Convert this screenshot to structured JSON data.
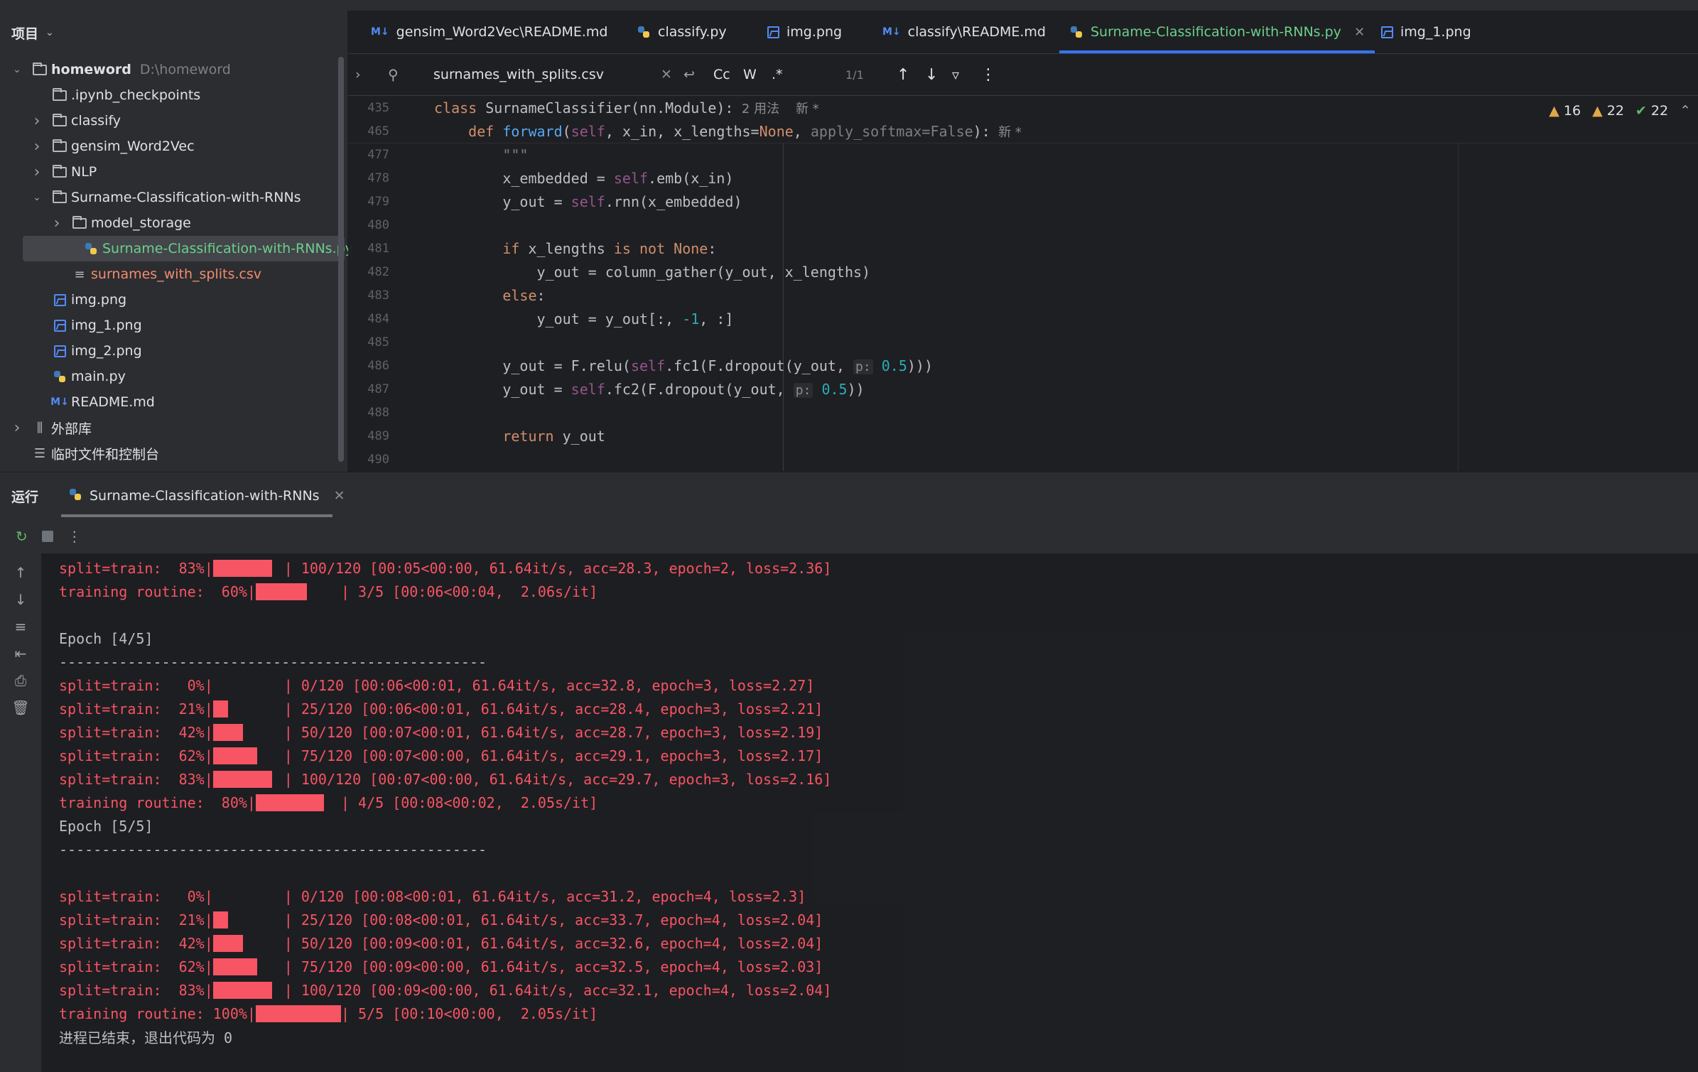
{
  "sidebar": {
    "title": "项目",
    "tree": [
      {
        "label": "homeword",
        "path": "D:\\homeword",
        "type": "folder",
        "level": 0,
        "expanded": true,
        "bold": true
      },
      {
        "label": ".ipynb_checkpoints",
        "type": "folder",
        "level": 1,
        "expanded": null
      },
      {
        "label": "classify",
        "type": "folder",
        "level": 1,
        "expanded": false
      },
      {
        "label": "gensim_Word2Vec",
        "type": "folder",
        "level": 1,
        "expanded": false
      },
      {
        "label": "NLP",
        "type": "folder",
        "level": 1,
        "expanded": false
      },
      {
        "label": "Surname-Classification-with-RNNs",
        "type": "folder",
        "level": 1,
        "expanded": true
      },
      {
        "label": "model_storage",
        "type": "folder",
        "level": 2,
        "expanded": false
      },
      {
        "label": "Surname-Classification-with-RNNs.py",
        "type": "py",
        "level": 2,
        "selected": true,
        "color": "#6ccf8b"
      },
      {
        "label": "surnames_with_splits.csv",
        "type": "csv",
        "level": 2,
        "color": "#f28c6f"
      },
      {
        "label": "img.png",
        "type": "img",
        "level": 1
      },
      {
        "label": "img_1.png",
        "type": "img",
        "level": 1
      },
      {
        "label": "img_2.png",
        "type": "img",
        "level": 1
      },
      {
        "label": "main.py",
        "type": "py",
        "level": 1
      },
      {
        "label": "README.md",
        "type": "md",
        "level": 1
      },
      {
        "label": "外部库",
        "type": "lib",
        "level": 0,
        "expanded": false
      },
      {
        "label": "临时文件和控制台",
        "type": "scratch",
        "level": 0
      }
    ]
  },
  "tabs": [
    {
      "label": "gensim_Word2Vec\\README.md",
      "icon": "md-icon"
    },
    {
      "label": "classify.py",
      "icon": "python-icon"
    },
    {
      "label": "img.png",
      "icon": "image-icon"
    },
    {
      "label": "classify\\README.md",
      "icon": "md-icon"
    },
    {
      "label": "Surname-Classification-with-RNNs.py",
      "icon": "python-icon",
      "active": true
    },
    {
      "label": "img_1.png",
      "icon": "image-icon"
    }
  ],
  "find": {
    "query": "surnames_with_splits.csv",
    "case_label": "Cc",
    "word_label": "W",
    "regex_label": ".*",
    "match_count": "1/1"
  },
  "inspections": {
    "warnings": "16",
    "weak_warnings": "22",
    "ok": "22"
  },
  "sticky": [
    {
      "ln": "435",
      "segments": [
        [
          "kw",
          "class "
        ],
        [
          "",
          "SurnameClassifier(nn.Module):"
        ],
        [
          "meta",
          "  2 用法    新 *"
        ]
      ]
    },
    {
      "ln": "465",
      "segments": [
        [
          "",
          "    "
        ],
        [
          "kw",
          "def "
        ],
        [
          "fn",
          "forward"
        ],
        [
          "",
          "("
        ],
        [
          "slf",
          "self"
        ],
        [
          "",
          ", x_in, x_lengths="
        ],
        [
          "kw",
          "None"
        ],
        [
          "",
          ", "
        ],
        [
          "cmt",
          "apply_softmax=False"
        ],
        [
          "",
          "):"
        ],
        [
          "meta",
          "  新 *"
        ]
      ]
    }
  ],
  "code": [
    {
      "ln": "477",
      "segments": [
        [
          "cmt",
          "        \"\"\""
        ]
      ]
    },
    {
      "ln": "478",
      "segments": [
        [
          "",
          "        x_embedded = "
        ],
        [
          "slf",
          "self"
        ],
        [
          "",
          ".emb(x_in)"
        ]
      ]
    },
    {
      "ln": "479",
      "segments": [
        [
          "",
          "        y_out = "
        ],
        [
          "slf",
          "self"
        ],
        [
          "",
          ".rnn(x_embedded)"
        ]
      ]
    },
    {
      "ln": "480",
      "segments": []
    },
    {
      "ln": "481",
      "segments": [
        [
          "kw",
          "        if "
        ],
        [
          "",
          "x_lengths "
        ],
        [
          "kw",
          "is not None"
        ],
        [
          "",
          ":"
        ]
      ]
    },
    {
      "ln": "482",
      "segments": [
        [
          "",
          "            y_out = column_gather(y_out, x_lengths)"
        ]
      ]
    },
    {
      "ln": "483",
      "segments": [
        [
          "kw",
          "        else"
        ],
        [
          "",
          ":"
        ]
      ]
    },
    {
      "ln": "484",
      "segments": [
        [
          "",
          "            y_out = y_out[:, "
        ],
        [
          "num",
          "-1"
        ],
        [
          "",
          ", :]"
        ]
      ]
    },
    {
      "ln": "485",
      "segments": []
    },
    {
      "ln": "486",
      "segments": [
        [
          "",
          "        y_out = F.relu("
        ],
        [
          "slf",
          "self"
        ],
        [
          "",
          ".fc1(F.dropout(y_out, "
        ],
        [
          "hint",
          "p:"
        ],
        [
          "num",
          " 0.5"
        ],
        [
          "",
          ")))"
        ]
      ]
    },
    {
      "ln": "487",
      "segments": [
        [
          "",
          "        y_out = "
        ],
        [
          "slf",
          "self"
        ],
        [
          "",
          ".fc2(F.dropout(y_out, "
        ],
        [
          "hint",
          "p:"
        ],
        [
          "num",
          " 0.5"
        ],
        [
          "",
          "))"
        ]
      ]
    },
    {
      "ln": "488",
      "segments": []
    },
    {
      "ln": "489",
      "segments": [
        [
          "kw",
          "        return "
        ],
        [
          "",
          "y_out"
        ]
      ]
    },
    {
      "ln": "490",
      "segments": []
    }
  ],
  "run": {
    "title": "运行",
    "tab_label": "Surname-Classification-with-RNNs"
  },
  "console": [
    {
      "pre": "split=train:  83%|",
      "fill": 0.83,
      "post": "| 100/120 [00:05<00:00, 61.64it/s, acc=28.3, epoch=2, loss=2.36]"
    },
    {
      "pre": "training routine:  60%|",
      "fill": 0.6,
      "post": "| 3/5 [00:06<00:04,  2.06s/it]",
      "wide": true
    },
    {
      "text": ""
    },
    {
      "text": "Epoch [4/5]",
      "plain": true
    },
    {
      "text": "--------------------------------------------------",
      "plain": true
    },
    {
      "pre": "split=train:   0%|",
      "fill": 0,
      "post": "| 0/120 [00:06<00:01, 61.64it/s, acc=32.8, epoch=3, loss=2.27]"
    },
    {
      "pre": "split=train:  21%|",
      "fill": 0.21,
      "post": "| 25/120 [00:06<00:01, 61.64it/s, acc=28.4, epoch=3, loss=2.21]"
    },
    {
      "pre": "split=train:  42%|",
      "fill": 0.42,
      "post": "| 50/120 [00:07<00:01, 61.64it/s, acc=28.7, epoch=3, loss=2.19]"
    },
    {
      "pre": "split=train:  62%|",
      "fill": 0.62,
      "post": "| 75/120 [00:07<00:00, 61.64it/s, acc=29.1, epoch=3, loss=2.17]"
    },
    {
      "pre": "split=train:  83%|",
      "fill": 0.83,
      "post": "| 100/120 [00:07<00:00, 61.64it/s, acc=29.7, epoch=3, loss=2.16]"
    },
    {
      "pre": "training routine:  80%|",
      "fill": 0.8,
      "post": "| 4/5 [00:08<00:02,  2.05s/it]",
      "wide": true
    },
    {
      "text": "Epoch [5/5]",
      "plain": true
    },
    {
      "text": "--------------------------------------------------",
      "plain": true
    },
    {
      "text": ""
    },
    {
      "pre": "split=train:   0%|",
      "fill": 0,
      "post": "| 0/120 [00:08<00:01, 61.64it/s, acc=31.2, epoch=4, loss=2.3]"
    },
    {
      "pre": "split=train:  21%|",
      "fill": 0.21,
      "post": "| 25/120 [00:08<00:01, 61.64it/s, acc=33.7, epoch=4, loss=2.04]"
    },
    {
      "pre": "split=train:  42%|",
      "fill": 0.42,
      "post": "| 50/120 [00:09<00:01, 61.64it/s, acc=32.6, epoch=4, loss=2.04]"
    },
    {
      "pre": "split=train:  62%|",
      "fill": 0.62,
      "post": "| 75/120 [00:09<00:00, 61.64it/s, acc=32.5, epoch=4, loss=2.03]"
    },
    {
      "pre": "split=train:  83%|",
      "fill": 0.83,
      "post": "| 100/120 [00:09<00:00, 61.64it/s, acc=32.1, epoch=4, loss=2.04]"
    },
    {
      "pre": "training routine: 100%|",
      "fill": 1.0,
      "post": "| 5/5 [00:10<00:00,  2.05s/it]",
      "wide": true
    },
    {
      "text": "进程已结束，退出代码为 0",
      "plain": true
    }
  ]
}
